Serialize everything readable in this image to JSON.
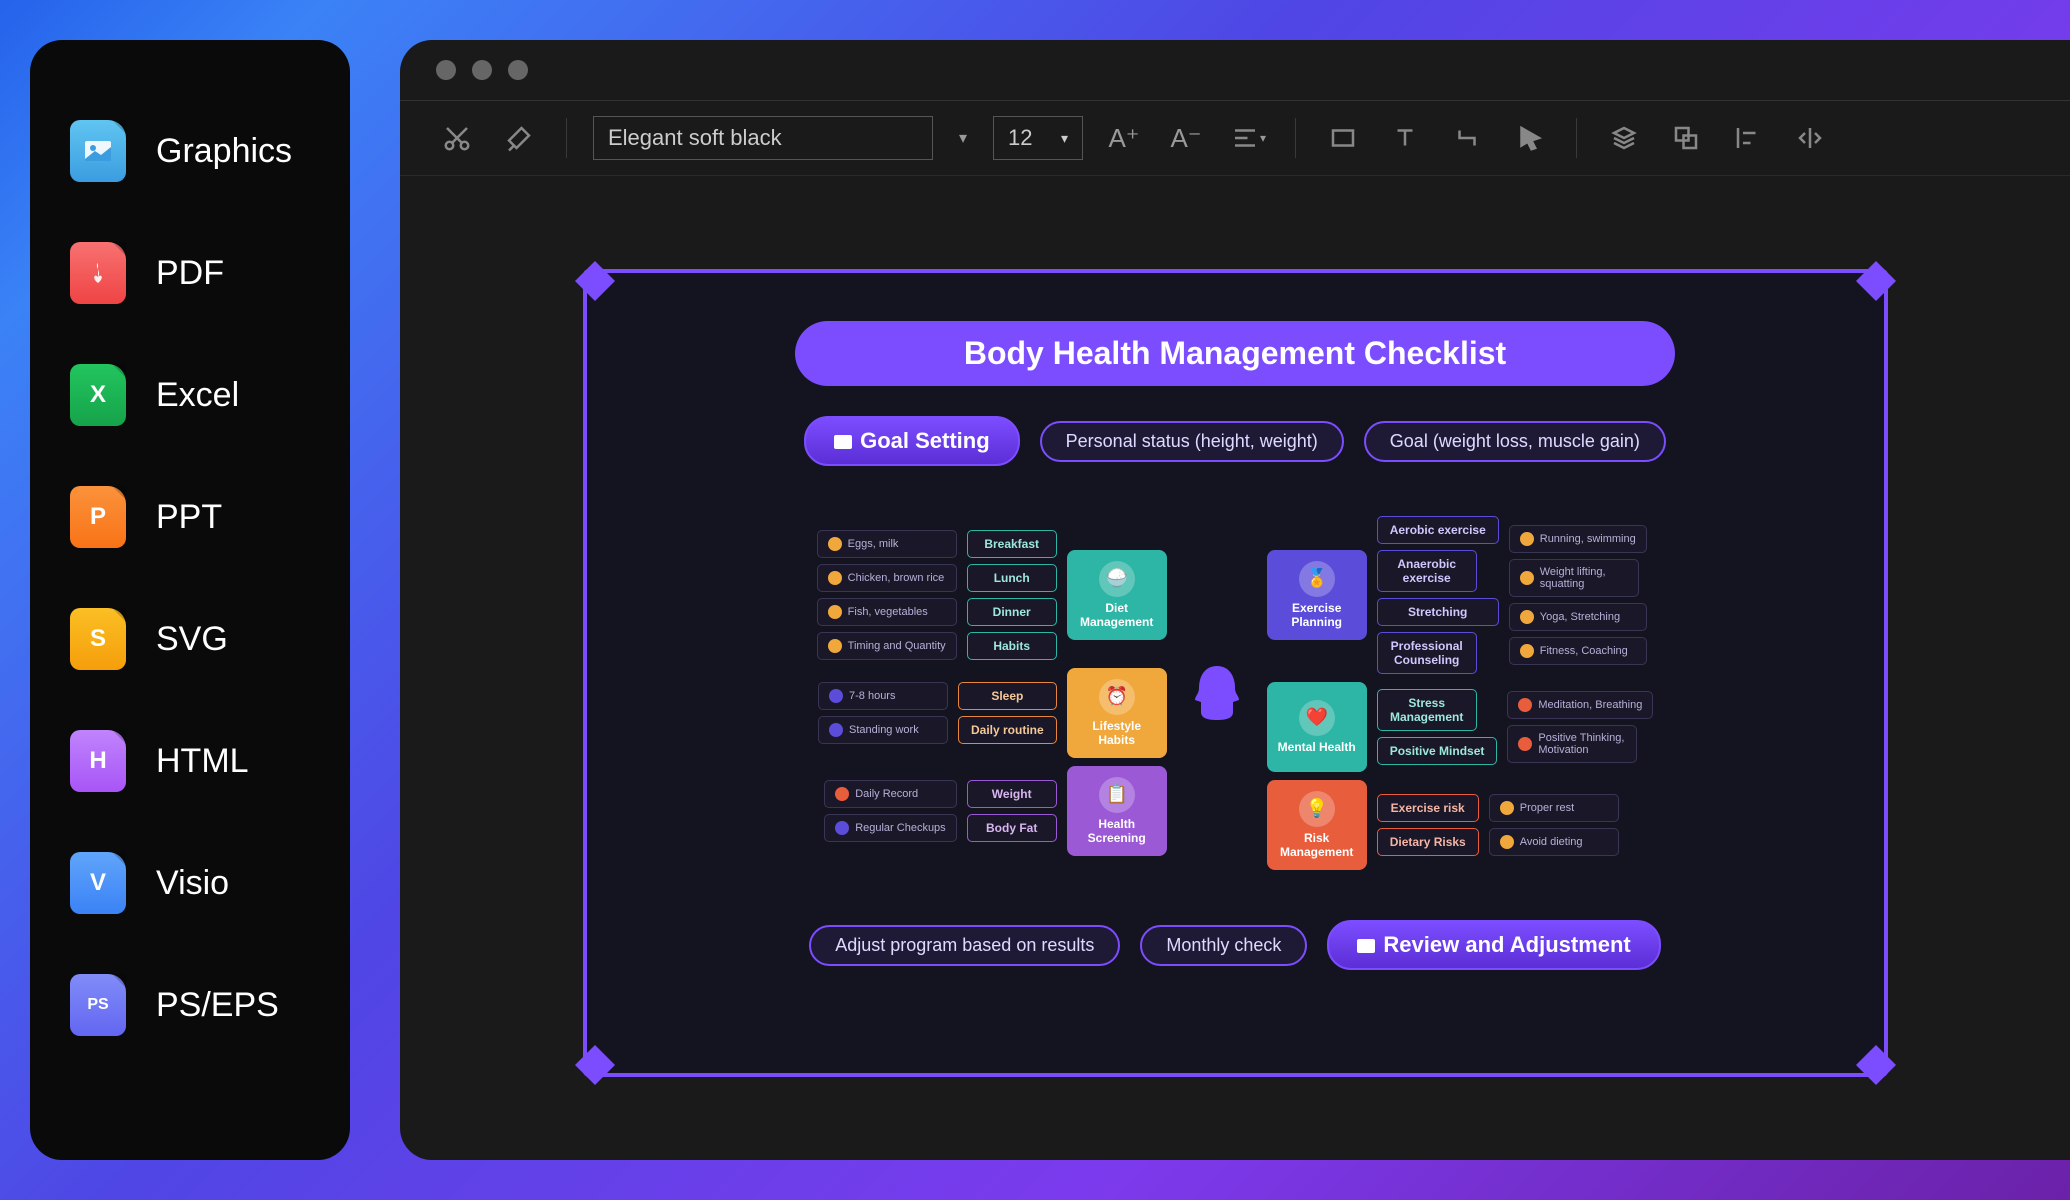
{
  "sidebar": {
    "items": [
      {
        "label": "Graphics",
        "icon": "image",
        "letter": ""
      },
      {
        "label": "PDF",
        "icon": "pdf",
        "letter": ""
      },
      {
        "label": "Excel",
        "icon": "excel",
        "letter": "X"
      },
      {
        "label": "PPT",
        "icon": "ppt",
        "letter": "P"
      },
      {
        "label": "SVG",
        "icon": "svg",
        "letter": "S"
      },
      {
        "label": "HTML",
        "icon": "html",
        "letter": "H"
      },
      {
        "label": "Visio",
        "icon": "visio",
        "letter": "V"
      },
      {
        "label": "PS/EPS",
        "icon": "ps",
        "letter": "PS"
      }
    ]
  },
  "toolbar": {
    "font": "Elegant soft black",
    "size": "12"
  },
  "mindmap": {
    "title": "Body Health Management Checklist",
    "top_row": {
      "main": "Goal Setting",
      "pill1": "Personal status (height, weight)",
      "pill2": "Goal (weight loss, muscle gain)"
    },
    "left": [
      {
        "category": "Diet Management",
        "subs": [
          "Breakfast",
          "Lunch",
          "Dinner",
          "Habits"
        ],
        "leaves": [
          "Eggs, milk",
          "Chicken, brown rice",
          "Fish, vegetables",
          "Timing and Quantity"
        ]
      },
      {
        "category": "Lifestyle Habits",
        "subs": [
          "Sleep",
          "Daily routine"
        ],
        "leaves": [
          "7-8 hours",
          "Standing work"
        ]
      },
      {
        "category": "Health Screening",
        "subs": [
          "Weight",
          "Body Fat"
        ],
        "leaves": [
          "Daily Record",
          "Regular Checkups"
        ]
      }
    ],
    "right": [
      {
        "category": "Exercise Planning",
        "subs": [
          "Aerobic exercise",
          "Anaerobic exercise",
          "Stretching",
          "Professional Counseling"
        ],
        "leaves": [
          "Running, swimming",
          "Weight lifting, squatting",
          "Yoga, Stretching",
          "Fitness, Coaching"
        ]
      },
      {
        "category": "Mental Health",
        "subs": [
          "Stress Management",
          "Positive Mindset"
        ],
        "leaves": [
          "Meditation, Breathing",
          "Positive Thinking, Motivation"
        ]
      },
      {
        "category": "Risk Management",
        "subs": [
          "Exercise risk",
          "Dietary Risks"
        ],
        "leaves": [
          "Proper rest",
          "Avoid dieting"
        ]
      }
    ],
    "bottom_row": {
      "pill1": "Adjust program based on results",
      "pill2": "Monthly check",
      "main": "Review and Adjustment"
    }
  }
}
